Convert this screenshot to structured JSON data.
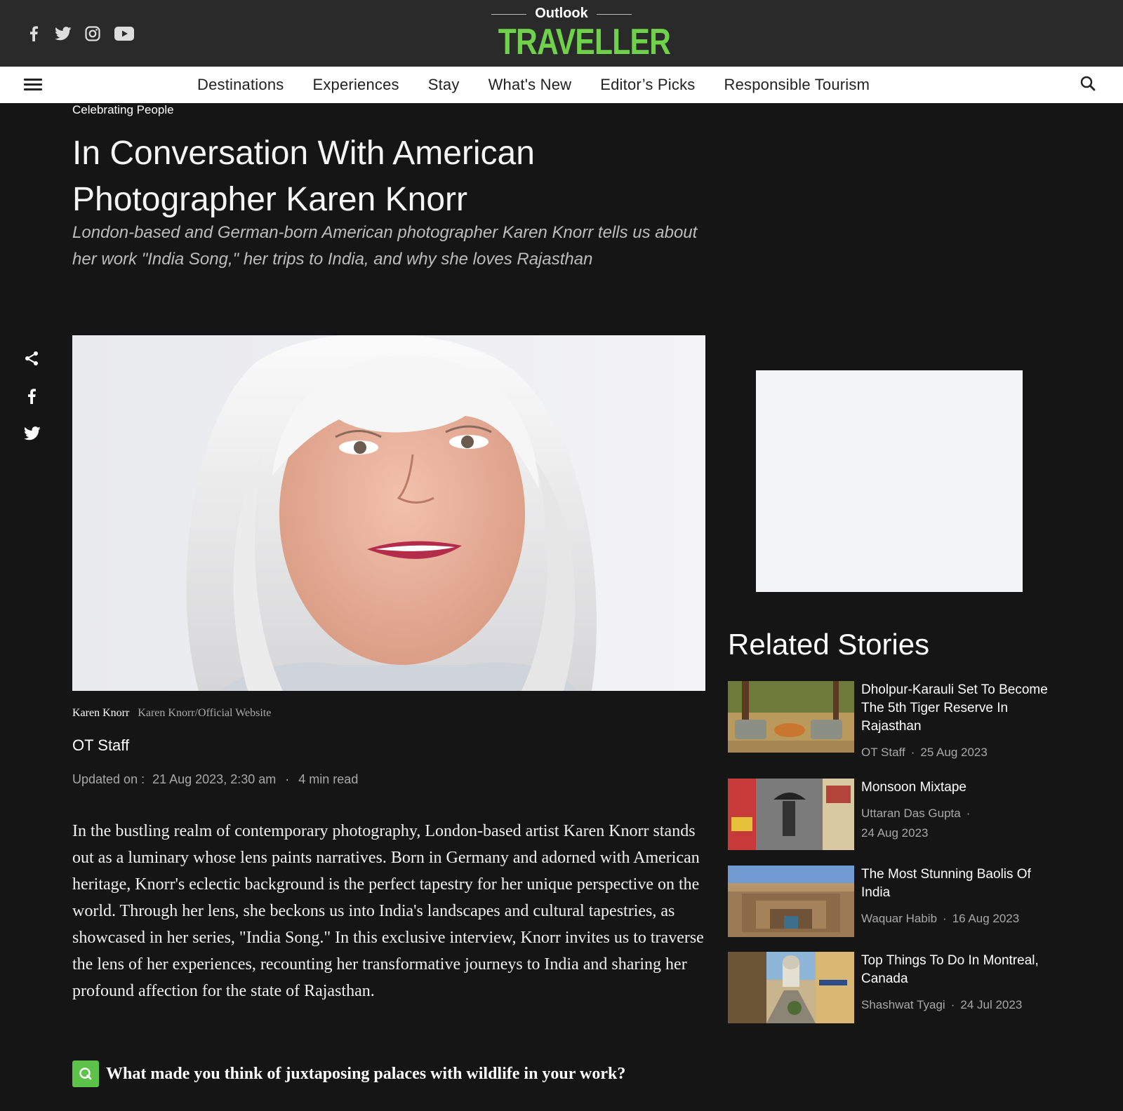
{
  "header": {
    "logo_top": "Outlook",
    "logo_main": "TRAVELLER",
    "social_icons": [
      "facebook-icon",
      "twitter-icon",
      "instagram-icon",
      "youtube-icon"
    ]
  },
  "nav": {
    "items": [
      {
        "label": "Destinations"
      },
      {
        "label": "Experiences"
      },
      {
        "label": "Stay"
      },
      {
        "label": "What's New"
      },
      {
        "label": "Editor’s Picks"
      },
      {
        "label": "Responsible Tourism"
      }
    ]
  },
  "article": {
    "category": "Celebrating People",
    "headline": "In Conversation With American Photographer Karen Knorr",
    "subhead": "London-based and German-born American photographer Karen Knorr tells us about her work \"India Song,\" her trips to India, and why she loves Rajasthan",
    "image_caption": "Karen Knorr",
    "image_credit": "Karen Knorr/Official Website",
    "author": "OT Staff",
    "updated_label": "Updated on :",
    "updated_date": "21 Aug 2023, 2:30 am",
    "read_time": "4 min read",
    "body": "In the bustling realm of contemporary photography, London-based artist Karen Knorr stands out as a luminary whose lens paints narratives. Born in Germany and adorned with American heritage, Knorr's eclectic background is the perfect tapestry for her unique perspective on the world. Through her lens, she beckons us into India's landscapes and cultural tapestries, as showcased in her series, \"India Song.\" In this exclusive interview, Knorr invites us to traverse the lens of her experiences, recounting her transformative journeys to India and sharing her profound affection for the state of Rajasthan.",
    "question_badge": "Q",
    "question": "What made you think of juxtaposing palaces with wildlife in your work?"
  },
  "sidebar": {
    "related_title": "Related Stories",
    "stories": [
      {
        "title": "Dholpur-Karauli Set To Become The 5th Tiger Reserve In Rajasthan",
        "author": "OT Staff",
        "date": "25 Aug 2023"
      },
      {
        "title": "Monsoon Mixtape",
        "author": "Uttaran Das Gupta",
        "date": "24 Aug 2023"
      },
      {
        "title": "The Most Stunning Baolis Of India",
        "author": "Waquar Habib",
        "date": "16 Aug 2023"
      },
      {
        "title": "Top Things To Do In Montreal, Canada",
        "author": "Shashwat Tyagi",
        "date": "24 Jul 2023"
      }
    ]
  },
  "colors": {
    "brand_green": "#6fd24a",
    "page_bg": "#151515",
    "header_bg": "#2a2a2a"
  }
}
